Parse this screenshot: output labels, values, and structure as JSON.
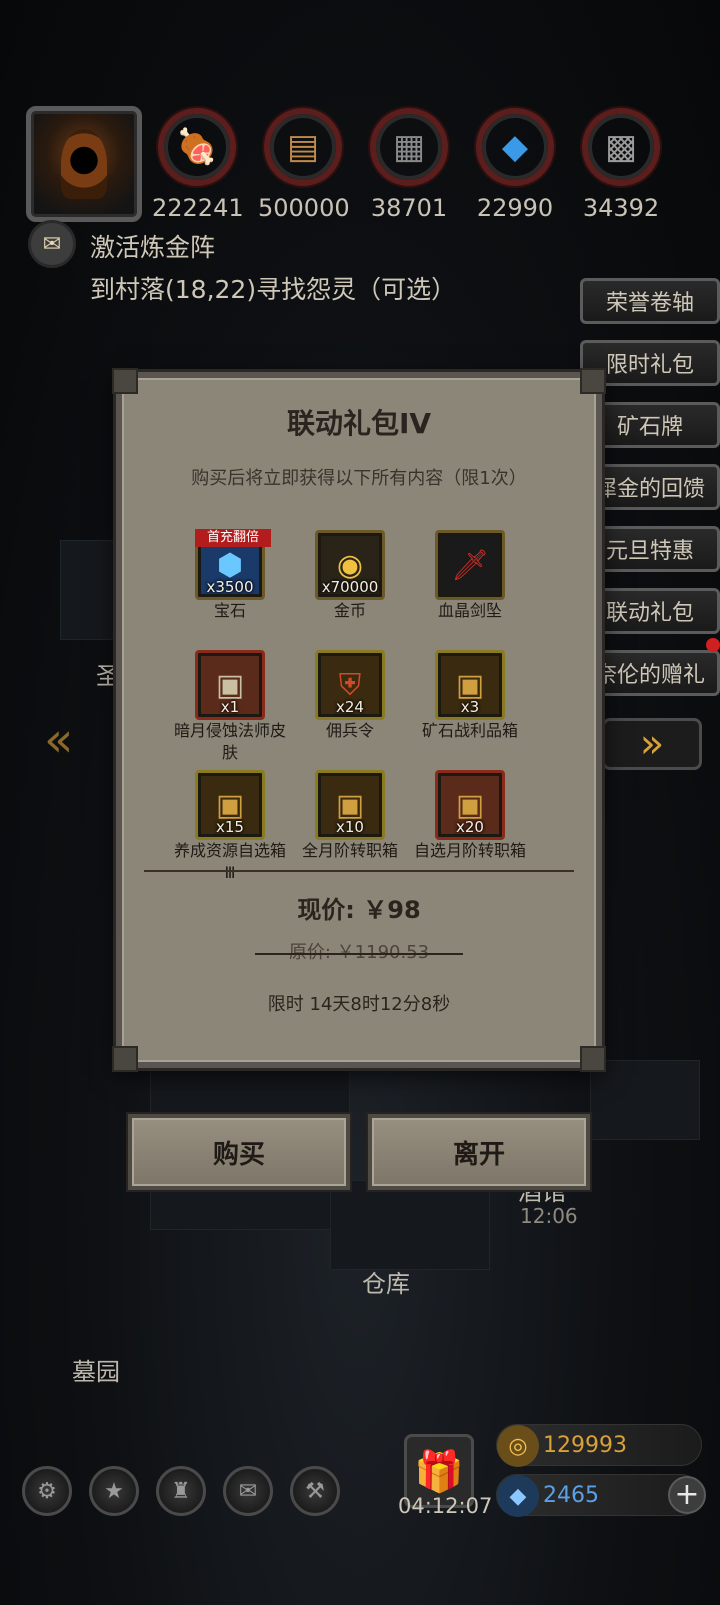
{
  "resources": [
    {
      "icon": "meat-icon",
      "value": "222241"
    },
    {
      "icon": "wood-icon",
      "value": "500000"
    },
    {
      "icon": "iron-icon",
      "value": "38701"
    },
    {
      "icon": "crystal-icon",
      "value": "22990"
    },
    {
      "icon": "ore-icon",
      "value": "34392"
    }
  ],
  "quest": {
    "title": "激活炼金阵",
    "description": "到村落(18,22)寻找怨灵（可选）"
  },
  "side_menu": [
    "荣誉卷轴",
    "限时礼包",
    "矿石牌",
    "犀金的回馈",
    "元旦特惠",
    "联动礼包",
    "奈伦的赠礼"
  ],
  "map_labels": {
    "left": "圣",
    "tavern": "酒馆",
    "tavern_time": "12:06",
    "warehouse": "仓库",
    "graveyard": "墓园"
  },
  "modal": {
    "title": "联动礼包IV",
    "subtitle": "购买后将立即获得以下所有内容（限1次）",
    "items": [
      {
        "name": "宝石",
        "count": "x3500",
        "badge": "首充翻倍",
        "icon": "gem-icon",
        "frame": "#6b5a28"
      },
      {
        "name": "金币",
        "count": "x70000",
        "badge": "",
        "icon": "gold-coin-icon",
        "frame": "#6b5a28"
      },
      {
        "name": "血晶剑坠",
        "count": "",
        "badge": "",
        "icon": "sword-pendant-icon",
        "frame": "#6b5a28"
      },
      {
        "name": "暗月侵蚀法师皮肤",
        "count": "x1",
        "badge": "",
        "icon": "chest-icon",
        "frame": "#8a2a1a"
      },
      {
        "name": "佣兵令",
        "count": "x24",
        "badge": "",
        "icon": "token-icon",
        "frame": "#8a7a20"
      },
      {
        "name": "矿石战利品箱",
        "count": "x3",
        "badge": "",
        "icon": "ore-chest-icon",
        "frame": "#8a7a20"
      },
      {
        "name": "养成资源自选箱Ⅲ",
        "count": "x15",
        "badge": "",
        "icon": "resource-chest-icon",
        "frame": "#8a7a20"
      },
      {
        "name": "全月阶转职箱",
        "count": "x10",
        "badge": "",
        "icon": "class-chest-icon",
        "frame": "#8a7a20"
      },
      {
        "name": "自选月阶转职箱",
        "count": "x20",
        "badge": "",
        "icon": "choice-chest-icon",
        "frame": "#8a2a1a"
      }
    ],
    "price_now": "现价: ￥98",
    "price_original": "原价: ￥1190.53",
    "timer": "限时 14天8时12分8秒"
  },
  "buttons": {
    "buy": "购买",
    "leave": "离开"
  },
  "bottom": {
    "gift_timer": "04:12:07",
    "gold": "129993",
    "gems": "2465",
    "gold_color": "#d8a23a",
    "gem_color": "#5aa0e8"
  }
}
